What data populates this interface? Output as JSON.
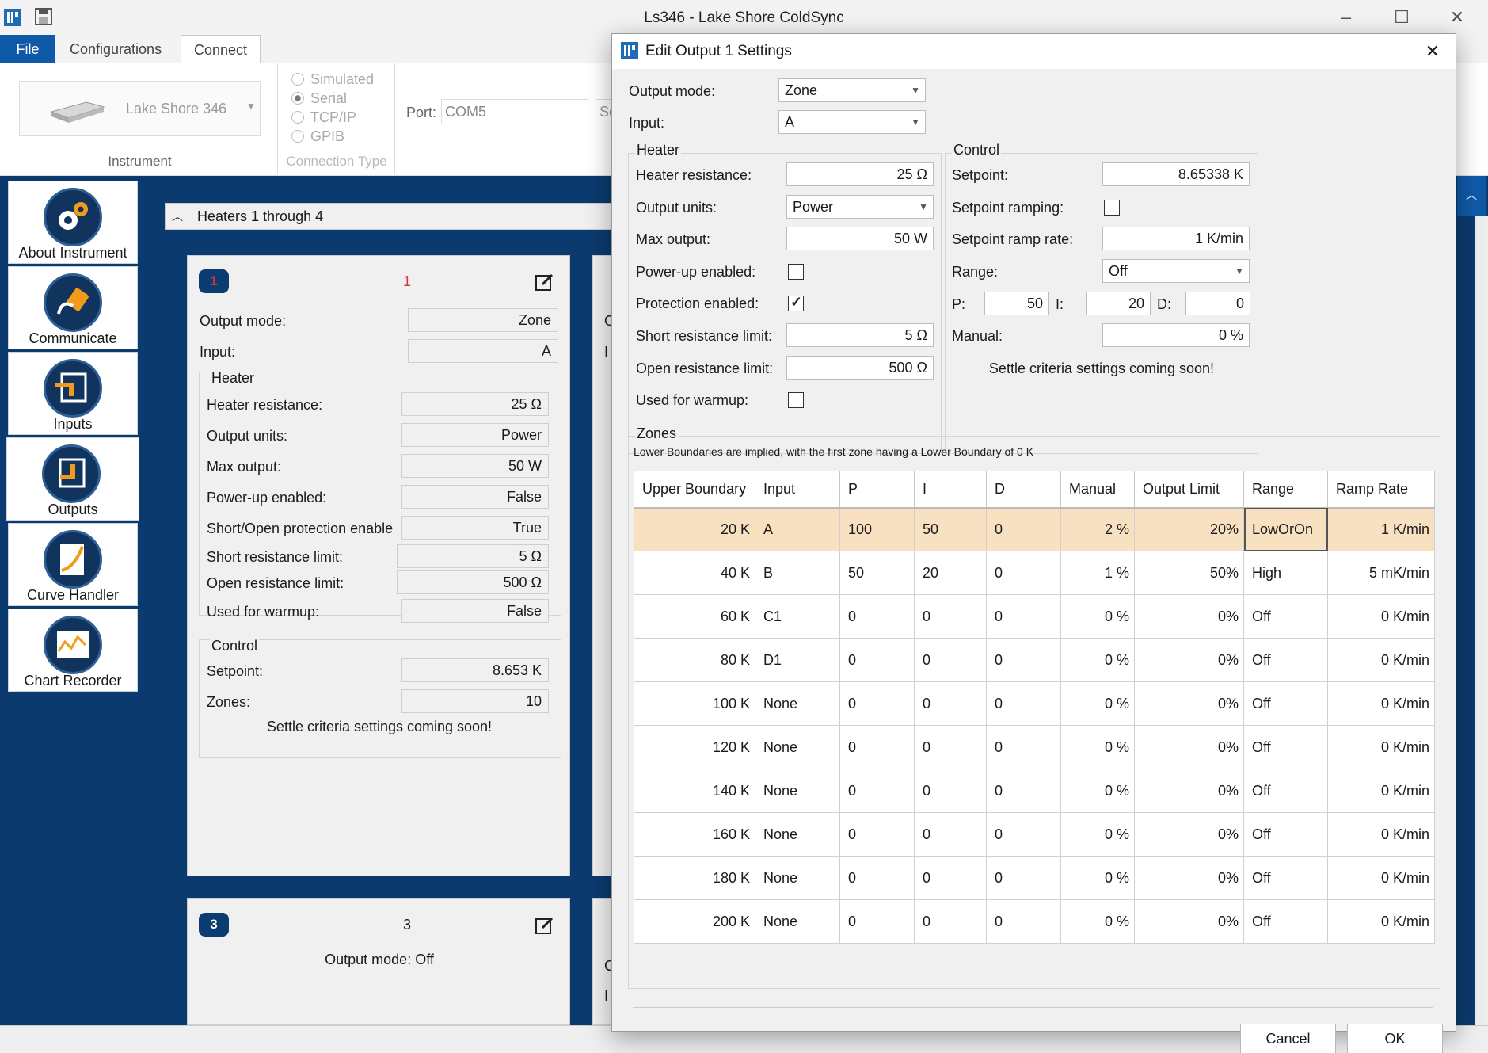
{
  "window": {
    "title": "Ls346 - Lake Shore ColdSync"
  },
  "ribbon": {
    "tabs": [
      "File",
      "Configurations",
      "Connect"
    ],
    "instrument": {
      "name": "Lake Shore 346",
      "group_label": "Instrument"
    },
    "connection_type": {
      "options": [
        "Simulated",
        "Serial",
        "TCP/IP",
        "GPIB"
      ],
      "selected": "Serial",
      "group_label": "Connection Type"
    },
    "port": {
      "label": "Port:",
      "value": "COM5",
      "button_partial": "Se"
    }
  },
  "nav": {
    "items": [
      {
        "label": "About Instrument",
        "icon": "gear-icon"
      },
      {
        "label": "Communicate",
        "icon": "plug-icon"
      },
      {
        "label": "Inputs",
        "icon": "input-arrow-icon"
      },
      {
        "label": "Outputs",
        "icon": "output-arrow-icon"
      },
      {
        "label": "Curve Handler",
        "icon": "curve-doc-icon"
      },
      {
        "label": "Chart Recorder",
        "icon": "chart-icon"
      }
    ],
    "selected": "Outputs"
  },
  "heaters": {
    "header": "Heaters 1 through 4",
    "card1": {
      "badge": "1",
      "title": "1",
      "output_mode_label": "Output mode:",
      "output_mode": "Zone",
      "input_label": "Input:",
      "input": "A",
      "heater_group": "Heater",
      "rows": [
        {
          "label": "Heater resistance:",
          "value": "25 Ω"
        },
        {
          "label": "Output units:",
          "value": "Power"
        },
        {
          "label": "Max output:",
          "value": "50 W"
        },
        {
          "label": "Power-up enabled:",
          "value": "False"
        },
        {
          "label": "Short/Open protection enable",
          "value": "True"
        },
        {
          "label": "Short resistance limit:",
          "value": "5 Ω"
        },
        {
          "label": "Open resistance limit:",
          "value": "500 Ω"
        },
        {
          "label": "Used for warmup:",
          "value": "False"
        }
      ],
      "control_group": "Control",
      "setpoint_label": "Setpoint:",
      "setpoint": "8.653 K",
      "zones_label": "Zones:",
      "zones": "10",
      "settle": "Settle criteria settings coming soon!"
    },
    "card3": {
      "badge": "3",
      "title": "3",
      "output_mode": "Output mode: Off"
    },
    "partial_letters": {
      "o": "O",
      "i": "I",
      "c": "C"
    }
  },
  "dialog": {
    "title": "Edit Output 1 Settings",
    "output_mode_label": "Output mode:",
    "output_mode": "Zone",
    "input_label": "Input:",
    "input": "A",
    "heater": {
      "group": "Heater",
      "heater_resistance_label": "Heater resistance:",
      "heater_resistance": "25 Ω",
      "output_units_label": "Output units:",
      "output_units": "Power",
      "max_output_label": "Max output:",
      "max_output": "50 W",
      "powerup_label": "Power-up enabled:",
      "powerup": false,
      "protection_label": "Protection enabled:",
      "protection": true,
      "short_label": "Short resistance limit:",
      "short": "5 Ω",
      "open_label": "Open resistance limit:",
      "open": "500 Ω",
      "warmup_label": "Used for warmup:",
      "warmup": false
    },
    "control": {
      "group": "Control",
      "setpoint_label": "Setpoint:",
      "setpoint": "8.65338 K",
      "ramping_label": "Setpoint ramping:",
      "ramping": false,
      "ramp_rate_label": "Setpoint ramp rate:",
      "ramp_rate": "1 K/min",
      "range_label": "Range:",
      "range": "Off",
      "p_label": "P:",
      "p": "50",
      "i_label": "I:",
      "i": "20",
      "d_label": "D:",
      "d": "0",
      "manual_label": "Manual:",
      "manual": "0 %",
      "settle": "Settle criteria settings coming soon!"
    },
    "zones": {
      "group": "Zones",
      "note": "Lower Boundaries are implied, with the first zone having a Lower Boundary of 0 K",
      "columns": [
        "Upper Boundary",
        "Input",
        "P",
        "I",
        "D",
        "Manual",
        "Output Limit",
        "Range",
        "Ramp Rate"
      ],
      "rows": [
        [
          "20 K",
          "A",
          "100",
          "50",
          "0",
          "2 %",
          "20%",
          "LowOrOn",
          "1 K/min"
        ],
        [
          "40 K",
          "B",
          "50",
          "20",
          "0",
          "1 %",
          "50%",
          "High",
          "5 mK/min"
        ],
        [
          "60 K",
          "C1",
          "0",
          "0",
          "0",
          "0 %",
          "0%",
          "Off",
          "0 K/min"
        ],
        [
          "80 K",
          "D1",
          "0",
          "0",
          "0",
          "0 %",
          "0%",
          "Off",
          "0 K/min"
        ],
        [
          "100 K",
          "None",
          "0",
          "0",
          "0",
          "0 %",
          "0%",
          "Off",
          "0 K/min"
        ],
        [
          "120 K",
          "None",
          "0",
          "0",
          "0",
          "0 %",
          "0%",
          "Off",
          "0 K/min"
        ],
        [
          "140 K",
          "None",
          "0",
          "0",
          "0",
          "0 %",
          "0%",
          "Off",
          "0 K/min"
        ],
        [
          "160 K",
          "None",
          "0",
          "0",
          "0",
          "0 %",
          "0%",
          "Off",
          "0 K/min"
        ],
        [
          "180 K",
          "None",
          "0",
          "0",
          "0",
          "0 %",
          "0%",
          "Off",
          "0 K/min"
        ],
        [
          "200 K",
          "None",
          "0",
          "0",
          "0",
          "0 %",
          "0%",
          "Off",
          "0 K/min"
        ]
      ],
      "selected_row": 0
    },
    "cancel": "Cancel",
    "ok": "OK"
  },
  "colors": {
    "accent": "#0f5aa8",
    "nav_bg": "#0b3a6e",
    "selected_row": "#f8e1c0"
  }
}
